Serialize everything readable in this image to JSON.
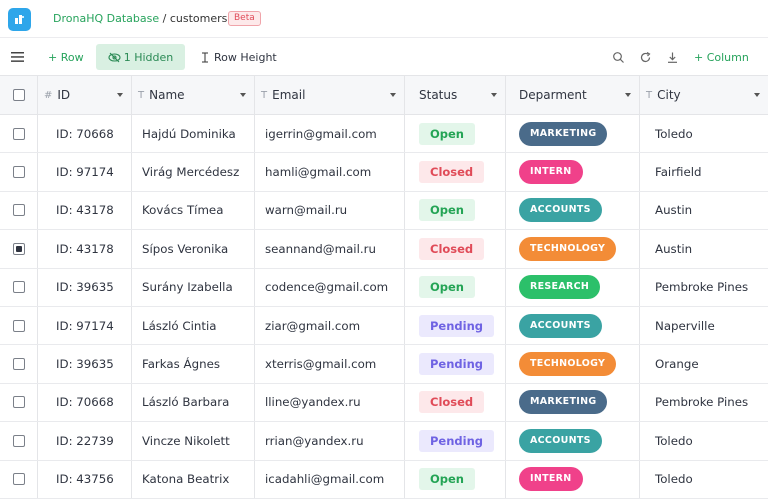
{
  "header": {
    "database": "DronaHQ Database",
    "separator": " / ",
    "table": "customers",
    "badge": "Beta"
  },
  "toolbar": {
    "add_row": "+ Row",
    "hidden": "1 Hidden",
    "row_height": "Row Height",
    "add_column": "+ Column",
    "icons": [
      "menu-icon",
      "eye-off-icon",
      "row-height-icon",
      "search-icon",
      "refresh-icon",
      "download-icon"
    ]
  },
  "columns": [
    {
      "type_icon": "#",
      "label": "ID"
    },
    {
      "type_icon": "T",
      "label": "Name"
    },
    {
      "type_icon": "T",
      "label": "Email"
    },
    {
      "type_icon": "",
      "label": "Status"
    },
    {
      "type_icon": "",
      "label": "Deparment"
    },
    {
      "type_icon": "T",
      "label": "City"
    }
  ],
  "colors": {
    "MARKETING": "#4a6b8a",
    "INTERN": "#f0418a",
    "ACCOUNTS": "#3aa3a3",
    "TECHNOLOGY": "#f38c37",
    "RESEARCH": "#2cc06a"
  },
  "rows": [
    {
      "id": "ID: 70668",
      "name": "Hajdú Dominika",
      "email": "igerrin@gmail.com",
      "status": "Open",
      "dept": "MARKETING",
      "city": "Toledo",
      "checked": false
    },
    {
      "id": "ID: 97174",
      "name": "Virág Mercédesz",
      "email": "hamli@gmail.com",
      "status": "Closed",
      "dept": "INTERN",
      "city": "Fairfield",
      "checked": false
    },
    {
      "id": "ID: 43178",
      "name": "Kovács Tímea",
      "email": "warn@mail.ru",
      "status": "Open",
      "dept": "ACCOUNTS",
      "city": "Austin",
      "checked": false
    },
    {
      "id": "ID: 43178",
      "name": "Sípos Veronika",
      "email": "seannand@mail.ru",
      "status": "Closed",
      "dept": "TECHNOLOGY",
      "city": "Austin",
      "checked": true
    },
    {
      "id": "ID: 39635",
      "name": "Surány Izabella",
      "email": "codence@gmail.com",
      "status": "Open",
      "dept": "RESEARCH",
      "city": "Pembroke Pines",
      "checked": false
    },
    {
      "id": "ID: 97174",
      "name": "László Cintia",
      "email": "ziar@gmail.com",
      "status": "Pending",
      "dept": "ACCOUNTS",
      "city": "Naperville",
      "checked": false
    },
    {
      "id": "ID: 39635",
      "name": "Farkas Ágnes",
      "email": "xterris@gmail.com",
      "status": "Pending",
      "dept": "TECHNOLOGY",
      "city": "Orange",
      "checked": false
    },
    {
      "id": "ID: 70668",
      "name": "László Barbara",
      "email": "lline@yandex.ru",
      "status": "Closed",
      "dept": "MARKETING",
      "city": "Pembroke Pines",
      "checked": false
    },
    {
      "id": "ID: 22739",
      "name": "Vincze Nikolett",
      "email": "rrian@yandex.ru",
      "status": "Pending",
      "dept": "ACCOUNTS",
      "city": "Toledo",
      "checked": false
    },
    {
      "id": "ID: 43756",
      "name": "Katona Beatrix",
      "email": "icadahli@gmail.com",
      "status": "Open",
      "dept": "INTERN",
      "city": "Toledo",
      "checked": false
    }
  ]
}
